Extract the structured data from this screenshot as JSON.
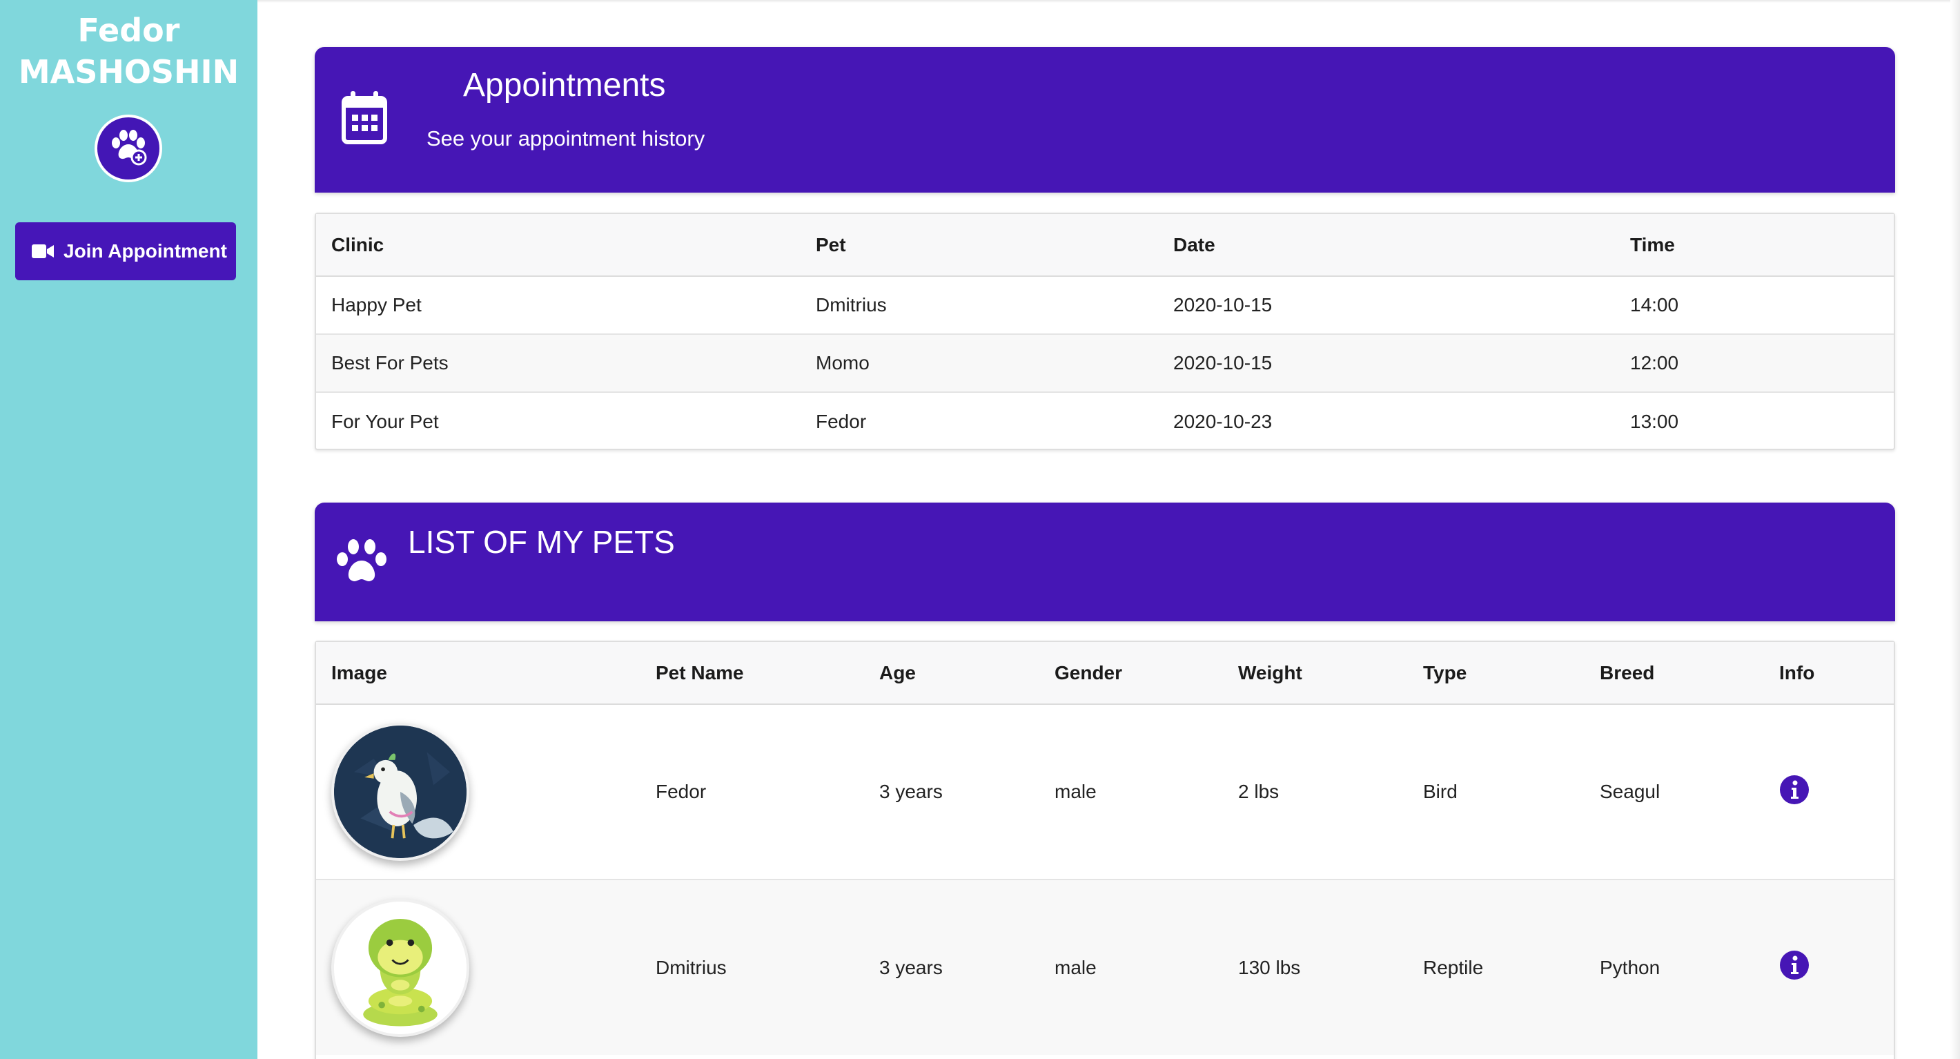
{
  "sidebar": {
    "user_first": "Fedor",
    "user_last": "MASHOSHIN",
    "avatar_icon": "paw-plus-icon",
    "join_button_label": "Join Appointment",
    "join_icon": "video-camera-icon"
  },
  "appointments": {
    "title": "Appointments",
    "subtitle": "See your appointment history",
    "icon": "calendar-icon",
    "columns": [
      "Clinic",
      "Pet",
      "Date",
      "Time"
    ],
    "rows": [
      [
        "Happy Pet",
        "Dmitrius",
        "2020-10-15",
        "14:00"
      ],
      [
        "Best For Pets",
        "Momo",
        "2020-10-15",
        "12:00"
      ],
      [
        "For Your Pet",
        "Fedor",
        "2020-10-23",
        "13:00"
      ]
    ]
  },
  "pets": {
    "title": "LIST OF MY PETS",
    "icon": "paw-icon",
    "columns": [
      "Image",
      "Pet Name",
      "Age",
      "Gender",
      "Weight",
      "Type",
      "Breed",
      "Info"
    ],
    "rows": [
      {
        "image": "seagull-bird-image",
        "name": "Fedor",
        "age": "3 years",
        "gender": "male",
        "weight": "2 lbs",
        "type": "Bird",
        "breed": "Seagul",
        "info_icon": "info-icon"
      },
      {
        "image": "green-snake-image",
        "name": "Dmitrius",
        "age": "3 years",
        "gender": "male",
        "weight": "130 lbs",
        "type": "Reptile",
        "breed": "Python",
        "info_icon": "info-icon"
      }
    ]
  },
  "colors": {
    "sidebar_bg": "#80d7dc",
    "accent": "#4616b5"
  }
}
